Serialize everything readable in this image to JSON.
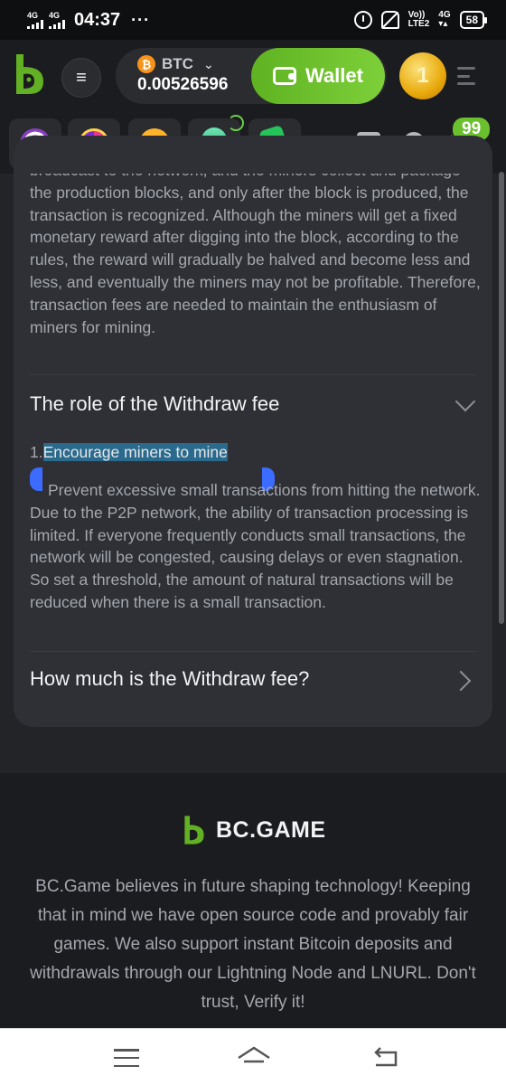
{
  "status_bar": {
    "net1": "4G",
    "net2": "4G",
    "time": "04:37",
    "dots": "···",
    "volte_top": "Vo))",
    "volte_bottom": "LTE2",
    "net3": "4G",
    "battery": "58"
  },
  "header": {
    "currency": "BTC",
    "balance": "0.00526596",
    "wallet_label": "Wallet",
    "avatar_letter": "1"
  },
  "icon_row": {
    "chat_badge": "99"
  },
  "faq": {
    "intro_text": "broadcast to the network, and the miners collect and package the production blocks, and only after the block is produced, the transaction is recognized. Although the miners will get a fixed monetary reward after digging into the block, according to the rules, the reward will gradually be halved and become less and less, and eventually the miners may not be profitable. Therefore, transaction fees are needed to maintain the enthusiasm of miners for mining.",
    "section1_title": "The role of the Withdraw fee",
    "point_number": "1.",
    "point_highlight": "Encourage miners to mine",
    "point_body": "Prevent excessive small transactions from hitting the network. Due to the P2P network, the ability of transaction processing is limited. If everyone frequently conducts small transactions, the network will be congested, causing delays or even stagnation. So set a threshold, the amount of natural transactions will be reduced when there is a small transaction.",
    "section2_title": "How much is the Withdraw fee?"
  },
  "footer": {
    "brand": "BC.GAME",
    "about": "BC.Game believes in future shaping technology! Keeping that in mind we have open source code and provably fair games. We also support instant Bitcoin deposits and withdrawals through our Lightning Node and LNURL. Don't trust, Verify it!"
  },
  "colors": {
    "background": "#232427",
    "card": "#2e3035",
    "accent_green": "#6bc02e",
    "highlight": "#2a6a8c",
    "handle_blue": "#3b6bff",
    "btc_orange": "#f7931a"
  }
}
